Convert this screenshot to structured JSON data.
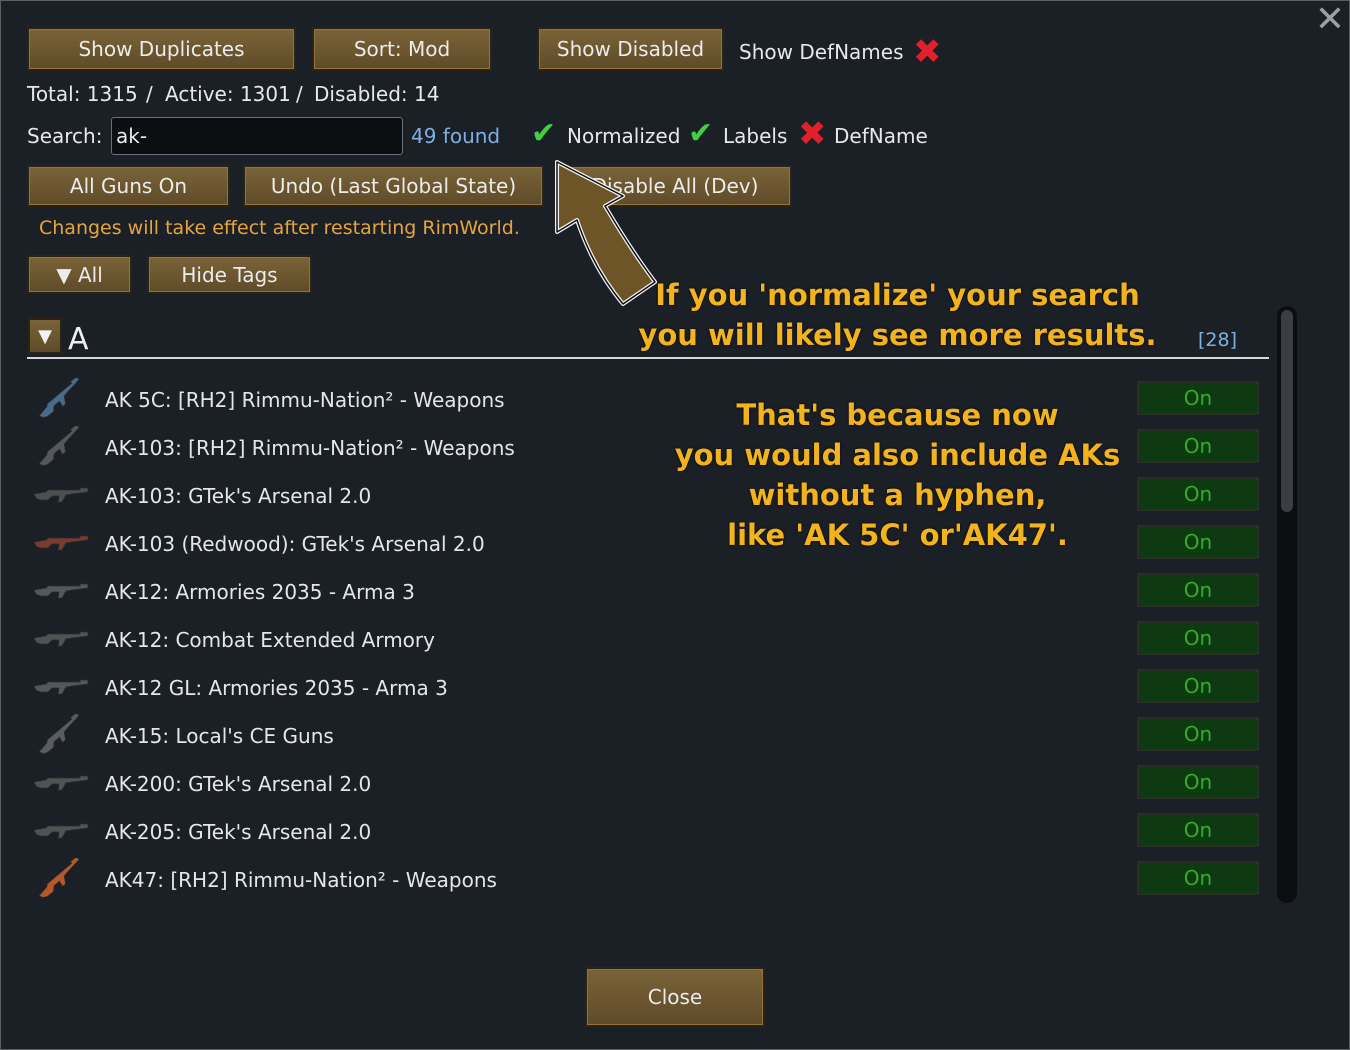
{
  "window": {
    "close_glyph": "✕"
  },
  "toolbar": {
    "show_duplicates": "Show Duplicates",
    "sort": "Sort: Mod",
    "show_disabled": "Show Disabled",
    "show_defnames": "Show DefNames"
  },
  "stats": {
    "total": "Total: 1315",
    "sep1": "/",
    "active": "Active: 1301",
    "sep2": "/",
    "disabled": "Disabled: 14"
  },
  "search": {
    "label": "Search:",
    "value": "ak-",
    "found": "49 found",
    "options": [
      {
        "label": "Normalized",
        "state": "on"
      },
      {
        "label": "Labels",
        "state": "on"
      },
      {
        "label": "DefName",
        "state": "off"
      }
    ]
  },
  "actions": {
    "all_guns_on": "All Guns On",
    "undo": "Undo (Last Global State)",
    "disable_all": "Disable All (Dev)"
  },
  "notice": "Changes will take effect after restarting RimWorld.",
  "filters": {
    "all": "▼ All",
    "hide_tags": "Hide Tags"
  },
  "section": {
    "toggle": "▼",
    "letter": "A",
    "count": "[28]"
  },
  "rows": [
    {
      "label": "AK 5C: [RH2] Rimmu-Nation² - Weapons",
      "state": "On",
      "icon": "rifle-icon",
      "color": "#4a6a8a"
    },
    {
      "label": "AK-103: [RH2] Rimmu-Nation² - Weapons",
      "state": "On",
      "icon": "rifle-icon",
      "color": "#56595c"
    },
    {
      "label": "AK-103: GTek's Arsenal 2.0",
      "state": "On",
      "icon": "rifle-icon",
      "color": "#4d4f52"
    },
    {
      "label": "AK-103 (Redwood): GTek's Arsenal 2.0",
      "state": "On",
      "icon": "rifle-icon",
      "color": "#7a3a30"
    },
    {
      "label": "AK-12: Armories 2035 - Arma 3",
      "state": "On",
      "icon": "rifle-icon",
      "color": "#55585b"
    },
    {
      "label": "AK-12: Combat Extended Armory",
      "state": "On",
      "icon": "rifle-icon",
      "color": "#505356"
    },
    {
      "label": "AK-12 GL: Armories 2035 - Arma 3",
      "state": "On",
      "icon": "rifle-icon",
      "color": "#55585b"
    },
    {
      "label": "AK-15: Local's CE Guns",
      "state": "On",
      "icon": "rifle-icon",
      "color": "#5a5d60"
    },
    {
      "label": "AK-200: GTek's Arsenal 2.0",
      "state": "On",
      "icon": "rifle-icon",
      "color": "#505356"
    },
    {
      "label": "AK-205: GTek's Arsenal 2.0",
      "state": "On",
      "icon": "rifle-icon",
      "color": "#505356"
    },
    {
      "label": "AK47: [RH2] Rimmu-Nation² - Weapons",
      "state": "On",
      "icon": "rifle-icon",
      "color": "#b5582a"
    }
  ],
  "annotations": {
    "tip1_line1": "If you 'normalize' your search",
    "tip1_line2": "you will likely see more results.",
    "tip2_line1": "That's because now",
    "tip2_line2": "you would also include AKs",
    "tip2_line3": "without a hyphen,",
    "tip2_line4": "like 'AK 5C' or'AK47'."
  },
  "footer": {
    "close": "Close"
  },
  "colors": {
    "button_brown": "#6e5731",
    "toggle_on_bg": "#0f3a11",
    "toggle_on_text": "#2fae2f",
    "annotation": "#f2b31d",
    "notice": "#e6a53a",
    "link_blue": "#7fb0e0"
  }
}
